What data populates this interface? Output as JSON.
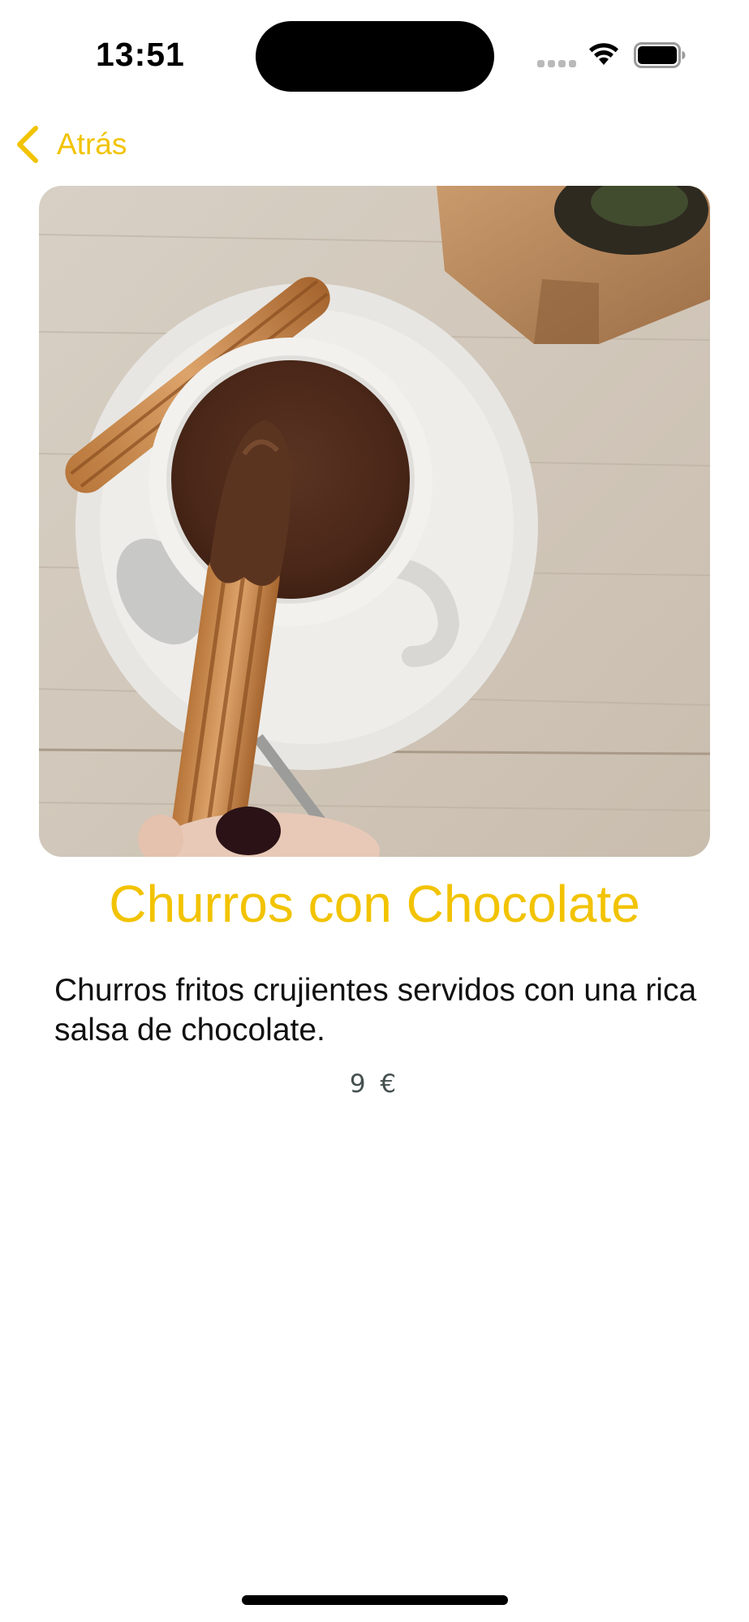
{
  "status_bar": {
    "time": "13:51"
  },
  "navigation": {
    "back_label": "Atrás",
    "back_icon": "chevron-left-icon"
  },
  "product": {
    "image_alt": "Churros dipped in hot chocolate cup",
    "title": "Churros con Chocolate",
    "description": "Churros fritos crujientes servidos con una rica salsa de chocolate.",
    "price": "9 €"
  },
  "colors": {
    "accent": "#f2c300",
    "price_text": "#45504f",
    "background": "#ffffff"
  }
}
